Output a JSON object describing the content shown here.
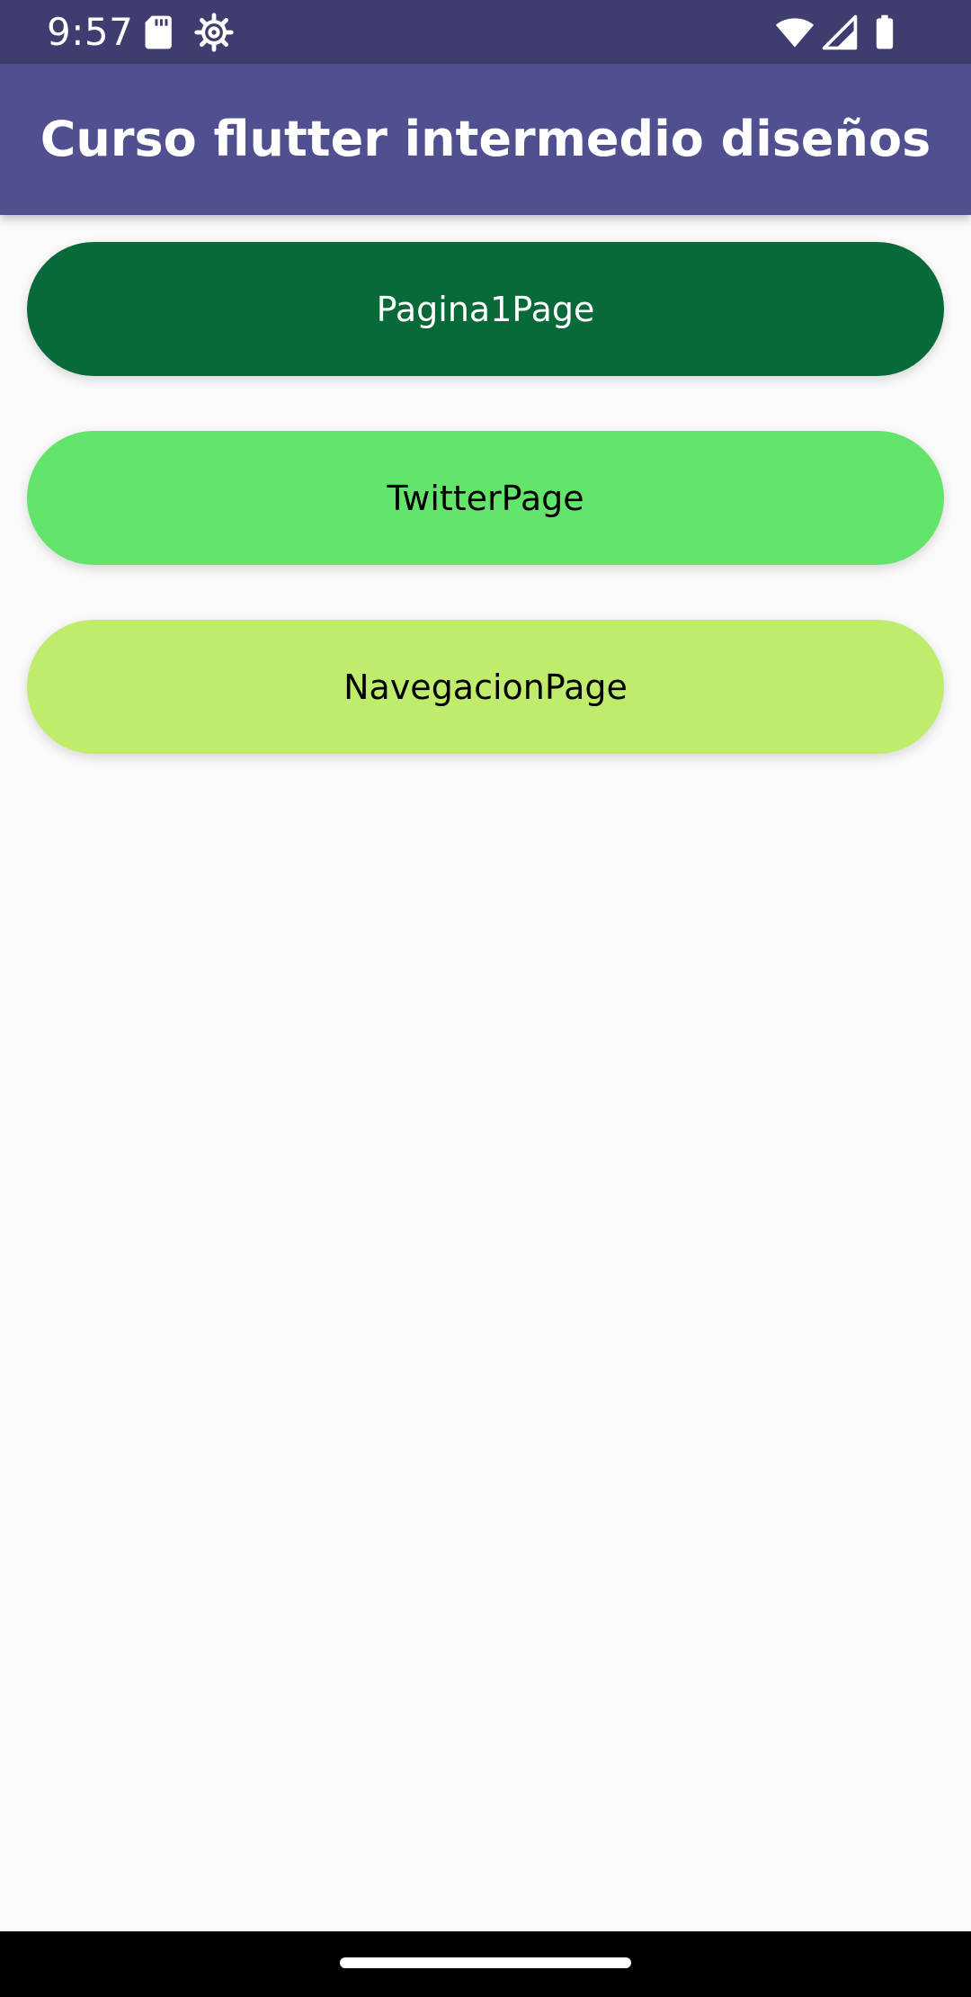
{
  "status_bar": {
    "time": "9:57",
    "icons_left": [
      "sd-card-icon",
      "settings-gear-icon"
    ],
    "icons_right": [
      "wifi-icon",
      "cell-signal-icon",
      "battery-icon"
    ],
    "background": "#3f3d6f"
  },
  "app_bar": {
    "title": "Curso flutter intermedio diseños",
    "background": "#505091"
  },
  "main": {
    "buttons": [
      {
        "label": "Pagina1Page",
        "background": "#086a39",
        "text_color": "#ffffff"
      },
      {
        "label": "TwitterPage",
        "background": "#63e46b",
        "text_color": "#000000"
      },
      {
        "label": "NavegacionPage",
        "background": "#bfec6b",
        "text_color": "#000000"
      }
    ]
  },
  "nav_bar": {
    "home_indicator": "home-indicator"
  }
}
